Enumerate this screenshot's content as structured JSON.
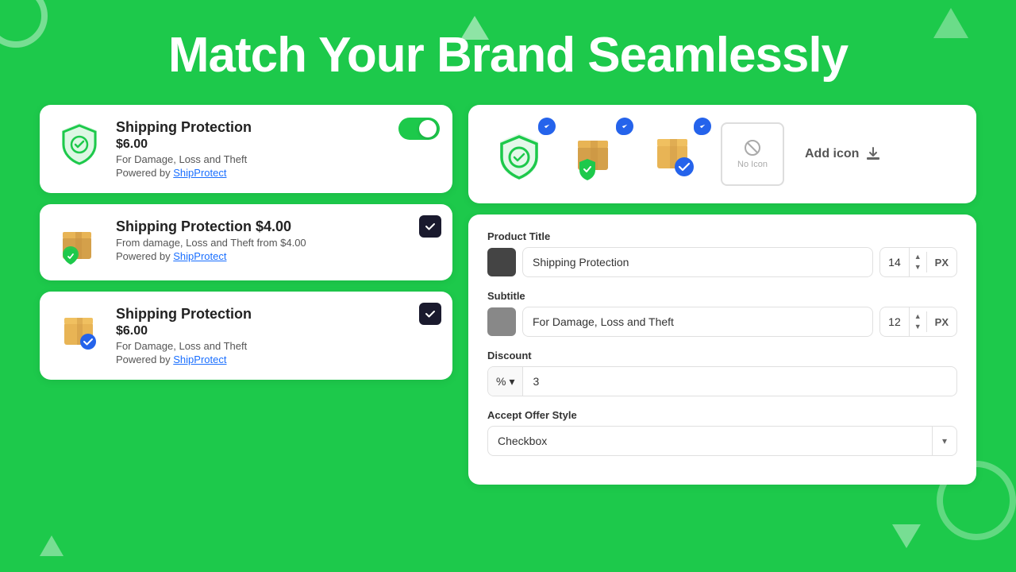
{
  "header": {
    "title": "Match Your Brand Seamlessly"
  },
  "cards": [
    {
      "id": "card1",
      "title": "Shipping Protection",
      "price": "$6.00",
      "description": "For Damage, Loss and Theft",
      "powered_prefix": "Powered by ",
      "powered_link": "ShipProtect",
      "control": "toggle",
      "icon_type": "shield"
    },
    {
      "id": "card2",
      "title": "Shipping Protection $4.00",
      "description": "From damage, Loss and Theft from $4.00",
      "powered_prefix": "Powered by ",
      "powered_link": "ShipProtect",
      "control": "checkbox",
      "icon_type": "box-shield"
    },
    {
      "id": "card3",
      "title": "Shipping Protection",
      "price": "$6.00",
      "description": "For Damage, Loss and Theft",
      "powered_prefix": "Powered by ",
      "powered_link": "ShipProtect",
      "control": "checkbox",
      "icon_type": "box-check"
    }
  ],
  "icon_picker": {
    "options": [
      {
        "id": "icon1",
        "type": "shield",
        "selected": true
      },
      {
        "id": "icon2",
        "type": "box-shield",
        "selected": true
      },
      {
        "id": "icon3",
        "type": "box-check",
        "selected": true
      },
      {
        "id": "icon4",
        "type": "none",
        "label": "No Icon"
      },
      {
        "id": "icon5",
        "type": "add",
        "label": "Add icon"
      }
    ]
  },
  "form": {
    "product_title_label": "Product Title",
    "product_title_swatch_color": "#444444",
    "product_title_value": "Shipping Protection",
    "product_title_size": "14",
    "product_title_unit": "PX",
    "subtitle_label": "Subtitle",
    "subtitle_swatch_color": "#888888",
    "subtitle_value": "For Damage, Loss and Theft",
    "subtitle_size": "12",
    "subtitle_unit": "PX",
    "discount_label": "Discount",
    "discount_prefix": "%",
    "discount_value": "3",
    "accept_offer_label": "Accept Offer Style",
    "accept_offer_value": "Checkbox"
  }
}
